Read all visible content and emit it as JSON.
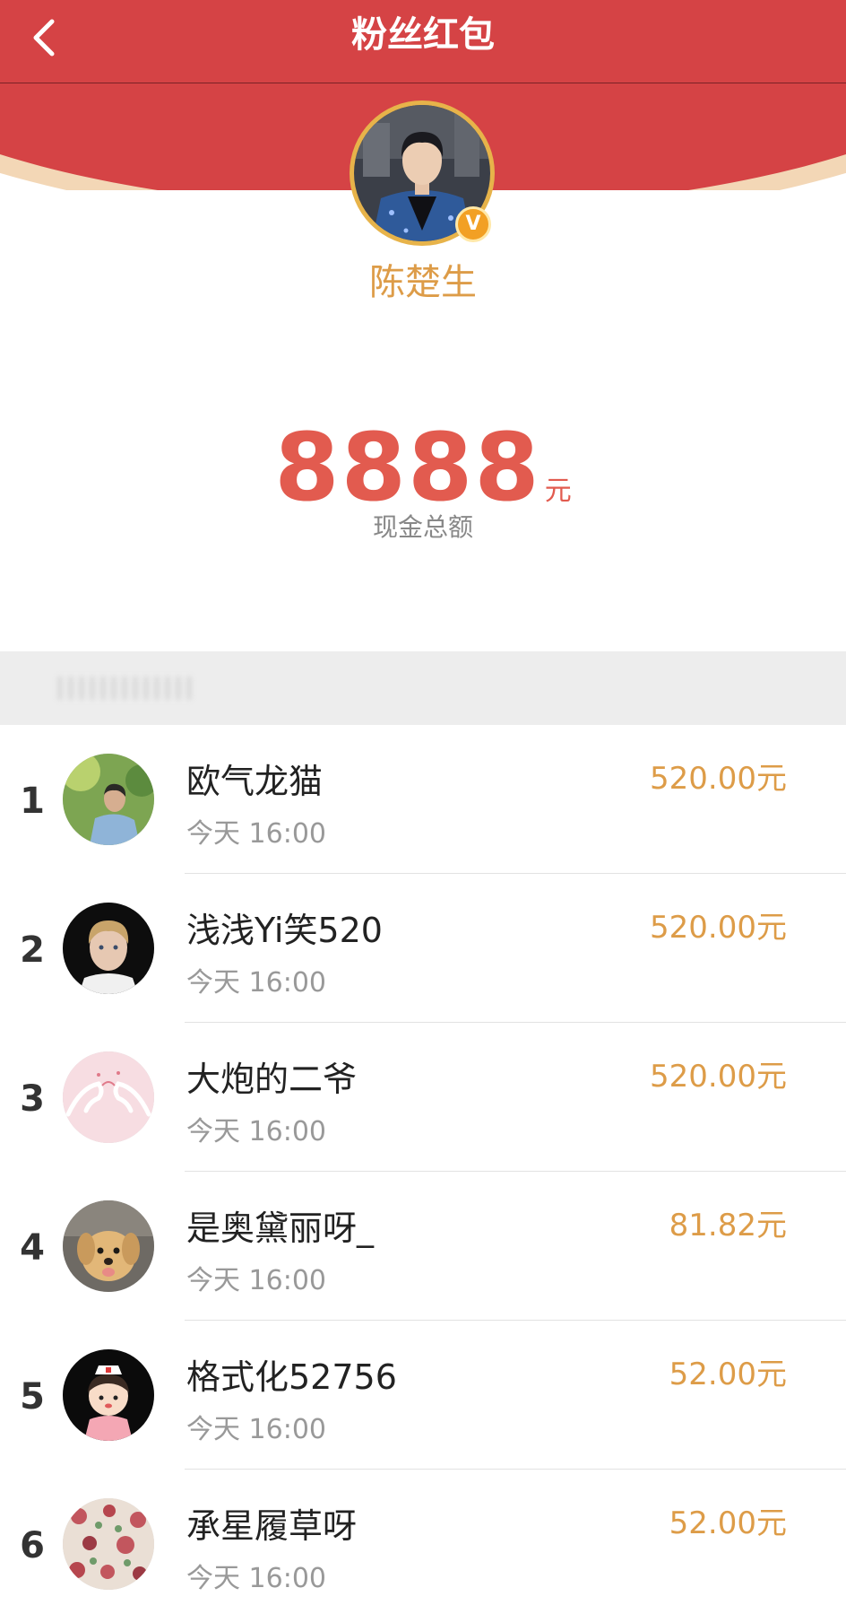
{
  "header": {
    "title": "粉丝红包",
    "back_icon": "chevron-left-icon",
    "color": "#d54345"
  },
  "profile": {
    "name": "陈楚生",
    "verified_badge": "V",
    "name_color": "#dd9c48"
  },
  "summary": {
    "amount": "8888",
    "unit": "元",
    "label": "现金总额",
    "amount_color": "#e25b4f"
  },
  "list": {
    "items": [
      {
        "rank": "1",
        "name": "欧气龙猫",
        "time": "今天 16:00",
        "amount": "520.00元",
        "avatar": "avatar-man-green"
      },
      {
        "rank": "2",
        "name": "浅浅Yi笑520",
        "time": "今天 16:00",
        "amount": "520.00元",
        "avatar": "avatar-man-portrait"
      },
      {
        "rank": "3",
        "name": "大炮的二爷",
        "time": "今天 16:00",
        "amount": "520.00元",
        "avatar": "avatar-pink-hands"
      },
      {
        "rank": "4",
        "name": "是奥黛丽呀_",
        "time": "今天 16:00",
        "amount": "81.82元",
        "avatar": "avatar-puppy"
      },
      {
        "rank": "5",
        "name": "格式化52756",
        "time": "今天 16:00",
        "amount": "52.00元",
        "avatar": "avatar-cartoon-nurse"
      },
      {
        "rank": "6",
        "name": "承星履草呀",
        "time": "今天 16:00",
        "amount": "52.00元",
        "avatar": "avatar-floral"
      }
    ],
    "amount_color": "#dd9c48"
  }
}
